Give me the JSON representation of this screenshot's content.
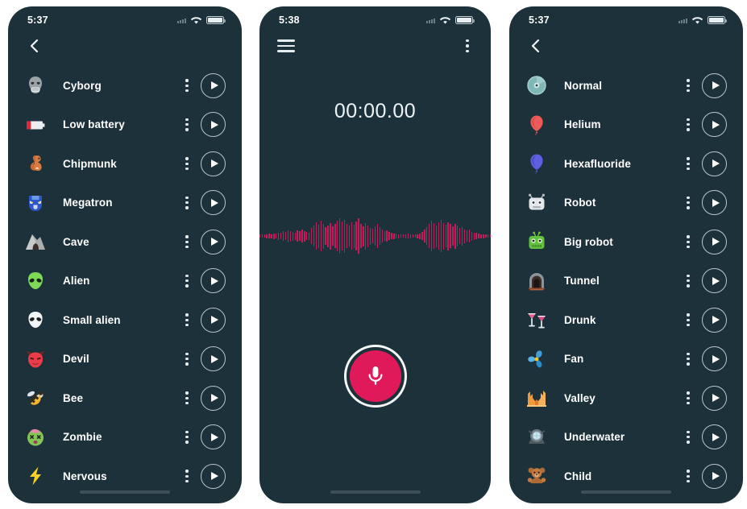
{
  "app": {
    "accent_color": "#e0195a",
    "panel_bg": "#1d313a",
    "waveform_color": "#c8195a",
    "page_bg": "#ffffff"
  },
  "panels": [
    {
      "name": "voice-effects-list",
      "status": {
        "time": "5:37",
        "wifi": "wifi-icon",
        "battery": "battery-icon",
        "signal": "signal-dots-icon"
      },
      "nav": {
        "left_icon": "back-chevron-icon",
        "right_icon": null
      },
      "items": [
        {
          "label": "Cyborg",
          "icon": "cyborg-icon",
          "glyph": "🤖",
          "kebab": "more-options-icon",
          "play": "play-icon"
        },
        {
          "label": "Low battery",
          "icon": "low-battery-icon",
          "glyph": "🔋",
          "kebab": "more-options-icon",
          "play": "play-icon"
        },
        {
          "label": "Chipmunk",
          "icon": "chipmunk-icon",
          "glyph": "🐿",
          "kebab": "more-options-icon",
          "play": "play-icon"
        },
        {
          "label": "Megatron",
          "icon": "megatron-icon",
          "glyph": "🤖",
          "kebab": "more-options-icon",
          "play": "play-icon"
        },
        {
          "label": "Cave",
          "icon": "cave-icon",
          "glyph": "🗿",
          "kebab": "more-options-icon",
          "play": "play-icon"
        },
        {
          "label": "Alien",
          "icon": "alien-icon",
          "glyph": "👽",
          "kebab": "more-options-icon",
          "play": "play-icon"
        },
        {
          "label": "Small alien",
          "icon": "small-alien-icon",
          "glyph": "👽",
          "kebab": "more-options-icon",
          "play": "play-icon"
        },
        {
          "label": "Devil",
          "icon": "devil-icon",
          "glyph": "👹",
          "kebab": "more-options-icon",
          "play": "play-icon"
        },
        {
          "label": "Bee",
          "icon": "bee-icon",
          "glyph": "🐝",
          "kebab": "more-options-icon",
          "play": "play-icon"
        },
        {
          "label": "Zombie",
          "icon": "zombie-icon",
          "glyph": "🧟",
          "kebab": "more-options-icon",
          "play": "play-icon"
        },
        {
          "label": "Nervous",
          "icon": "nervous-icon",
          "glyph": "⚡",
          "kebab": "more-options-icon",
          "play": "play-icon"
        }
      ]
    },
    {
      "name": "voice-recorder",
      "status": {
        "time": "5:38",
        "wifi": "wifi-icon",
        "battery": "battery-icon",
        "signal": "signal-dots-icon"
      },
      "nav": {
        "left_icon": "hamburger-menu-icon",
        "right_icon": "more-options-icon"
      },
      "timer": "00:00.00",
      "record_button": "record-button",
      "mic_icon": "microphone-icon",
      "waveform": {
        "name": "audio-waveform",
        "bars": [
          4,
          4,
          4,
          5,
          6,
          5,
          7,
          6,
          9,
          8,
          12,
          10,
          15,
          13,
          11,
          9,
          14,
          12,
          16,
          13,
          10,
          9,
          20,
          26,
          34,
          29,
          38,
          31,
          22,
          27,
          33,
          24,
          30,
          38,
          44,
          36,
          41,
          30,
          26,
          34,
          29,
          36,
          44,
          30,
          25,
          33,
          27,
          21,
          18,
          24,
          30,
          22,
          16,
          12,
          14,
          10,
          8,
          7,
          6,
          5,
          4,
          4,
          5,
          6,
          5,
          4,
          4,
          5,
          7,
          10,
          16,
          22,
          30,
          38,
          32,
          27,
          34,
          40,
          33,
          28,
          35,
          30,
          24,
          31,
          26,
          20,
          23,
          17,
          14,
          16,
          11,
          9,
          8,
          6,
          5,
          5,
          4,
          4,
          4
        ]
      }
    },
    {
      "name": "voice-effects-list-2",
      "status": {
        "time": "5:37",
        "wifi": "wifi-icon",
        "battery": "battery-icon",
        "signal": "signal-dots-icon"
      },
      "nav": {
        "left_icon": "back-chevron-icon",
        "right_icon": null
      },
      "items": [
        {
          "label": "Normal",
          "icon": "normal-disc-icon",
          "glyph": "💿",
          "kebab": "more-options-icon",
          "play": "play-icon"
        },
        {
          "label": "Helium",
          "icon": "helium-balloon-icon",
          "glyph": "🎈",
          "kebab": "more-options-icon",
          "play": "play-icon"
        },
        {
          "label": "Hexafluoride",
          "icon": "hexafluoride-balloon-icon",
          "glyph": "🎈",
          "kebab": "more-options-icon",
          "play": "play-icon"
        },
        {
          "label": "Robot",
          "icon": "robot-icon",
          "glyph": "🤖",
          "kebab": "more-options-icon",
          "play": "play-icon"
        },
        {
          "label": "Big robot",
          "icon": "big-robot-icon",
          "glyph": "🤖",
          "kebab": "more-options-icon",
          "play": "play-icon"
        },
        {
          "label": "Tunnel",
          "icon": "tunnel-icon",
          "glyph": "🚇",
          "kebab": "more-options-icon",
          "play": "play-icon"
        },
        {
          "label": "Drunk",
          "icon": "drunk-icon",
          "glyph": "🍸",
          "kebab": "more-options-icon",
          "play": "play-icon"
        },
        {
          "label": "Fan",
          "icon": "fan-icon",
          "glyph": "✹",
          "kebab": "more-options-icon",
          "play": "play-icon"
        },
        {
          "label": "Valley",
          "icon": "valley-icon",
          "glyph": "🏜",
          "kebab": "more-options-icon",
          "play": "play-icon"
        },
        {
          "label": "Underwater",
          "icon": "underwater-helmet-icon",
          "glyph": "🕵",
          "kebab": "more-options-icon",
          "play": "play-icon"
        },
        {
          "label": "Child",
          "icon": "child-teddy-icon",
          "glyph": "🧸",
          "kebab": "more-options-icon",
          "play": "play-icon"
        }
      ]
    }
  ]
}
